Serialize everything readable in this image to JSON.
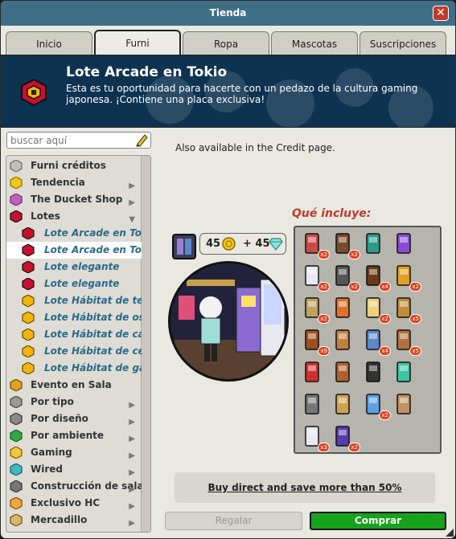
{
  "window": {
    "title": "Tienda",
    "close": "✕"
  },
  "tabs": [
    {
      "label": "Inicio"
    },
    {
      "label": "Furni"
    },
    {
      "label": "Ropa"
    },
    {
      "label": "Mascotas"
    },
    {
      "label": "Suscripciones"
    }
  ],
  "active_tab": "Furni",
  "banner": {
    "title": "Lote Arcade en Tokio",
    "description": "Esta es tu oportunidad para hacerte con un pedazo de la cultura gaming japonesa. ¡Contiene una placa exclusiva!"
  },
  "search": {
    "placeholder": "buscar aquí",
    "icon": "pencil-icon"
  },
  "nav": {
    "items": [
      {
        "label": "Furni créditos",
        "icon": "coins-icon",
        "level": 0,
        "chevron": ""
      },
      {
        "label": "Tendencia",
        "icon": "star-icon",
        "level": 0,
        "chevron": "▶"
      },
      {
        "label": "The Ducket Shop",
        "icon": "ducket-icon",
        "level": 0,
        "chevron": "▶"
      },
      {
        "label": "Lotes",
        "icon": "bundle-icon",
        "level": 0,
        "chevron": "▼"
      },
      {
        "label": "Lote Arcade en Tokio",
        "icon": "bundle-icon",
        "level": 1,
        "chevron": ""
      },
      {
        "label": "Lote Arcade en Tokio",
        "icon": "bundle-icon",
        "level": 1,
        "chevron": "",
        "selected": true
      },
      {
        "label": "Lote elegante",
        "icon": "bundle-icon",
        "level": 1,
        "chevron": ""
      },
      {
        "label": "Lote elegante",
        "icon": "bundle-icon",
        "level": 1,
        "chevron": ""
      },
      {
        "label": "Lote Hábitat de terriers",
        "icon": "bundle-gold-icon",
        "level": 1,
        "chevron": ""
      },
      {
        "label": "Lote Hábitat de osito polar",
        "icon": "bundle-gold-icon",
        "level": 1,
        "chevron": ""
      },
      {
        "label": "Lote Hábitat de cachorro",
        "icon": "bundle-gold-icon",
        "level": 1,
        "chevron": ""
      },
      {
        "label": "Lote Hábitat de cerditos",
        "icon": "bundle-gold-icon",
        "level": 1,
        "chevron": ""
      },
      {
        "label": "Lote Hábitat de gatitos",
        "icon": "bundle-gold-icon",
        "level": 1,
        "chevron": ""
      },
      {
        "label": "Evento en Sala",
        "icon": "event-icon",
        "level": 0,
        "chevron": ""
      },
      {
        "label": "Por tipo",
        "icon": "furni-type-icon",
        "level": 0,
        "chevron": "▶"
      },
      {
        "label": "Por diseño",
        "icon": "columns-icon",
        "level": 0,
        "chevron": "▶"
      },
      {
        "label": "Por ambiente",
        "icon": "plant-icon",
        "level": 0,
        "chevron": "▶"
      },
      {
        "label": "Gaming",
        "icon": "trophy-icon",
        "level": 0,
        "chevron": "▶"
      },
      {
        "label": "Wired",
        "icon": "wired-icon",
        "level": 0,
        "chevron": "▶"
      },
      {
        "label": "Construcción de salas",
        "icon": "hammer-icon",
        "level": 0,
        "chevron": "▶"
      },
      {
        "label": "Exclusivo HC",
        "icon": "hc-icon",
        "level": 0,
        "chevron": "▶"
      },
      {
        "label": "Mercadillo",
        "icon": "market-icon",
        "level": 0,
        "chevron": "▶"
      }
    ]
  },
  "product": {
    "availability": "Also available in the Credit page.",
    "price_credits": "45",
    "price_plus": "+ 45",
    "includes_title": "Qué incluye:",
    "items": [
      {
        "icon": "poster-icon",
        "badge": "x2"
      },
      {
        "icon": "arcade-door-icon",
        "badge": "x2"
      },
      {
        "icon": "stool-icon",
        "badge": ""
      },
      {
        "icon": "arcade-machine-icon",
        "badge": ""
      },
      {
        "icon": "cube-icon",
        "badge": "x2"
      },
      {
        "icon": "lamp-post-icon",
        "badge": "x2"
      },
      {
        "icon": "door-icon",
        "badge": "x4"
      },
      {
        "icon": "frame-icon",
        "badge": "x2"
      },
      {
        "icon": "cushion-icon",
        "badge": "x2"
      },
      {
        "icon": "poster-orange-icon",
        "badge": ""
      },
      {
        "icon": "noodle-icon",
        "badge": "x2"
      },
      {
        "icon": "window-icon",
        "badge": "x5"
      },
      {
        "icon": "table-icon",
        "badge": "x9"
      },
      {
        "icon": "tray-icon",
        "badge": ""
      },
      {
        "icon": "tile-icon",
        "badge": "x4"
      },
      {
        "icon": "gate-icon",
        "badge": "x5"
      },
      {
        "icon": "vending-red-icon",
        "badge": ""
      },
      {
        "icon": "rug-icon",
        "badge": ""
      },
      {
        "icon": "speaker-icon",
        "badge": ""
      },
      {
        "icon": "plant-neon-icon",
        "badge": ""
      },
      {
        "icon": "shelf-icon",
        "badge": ""
      },
      {
        "icon": "lights-icon",
        "badge": ""
      },
      {
        "icon": "sign-icon",
        "badge": "x2"
      },
      {
        "icon": "partition-icon",
        "badge": ""
      },
      {
        "icon": "vending-white-icon",
        "badge": "x3"
      },
      {
        "icon": "arcade-blue-icon",
        "badge": "x2"
      }
    ],
    "buy_direct": "Buy direct and save more than 50%"
  },
  "buttons": {
    "gift": "Regalar",
    "buy": "Comprar"
  },
  "colors": {
    "titlebar": "#3f6f86",
    "banner": "#0d3350",
    "accent_red": "#c0392b",
    "buy_green": "#17a21c",
    "link_blue": "#2a6a8a",
    "badge_red": "#e2401f"
  }
}
